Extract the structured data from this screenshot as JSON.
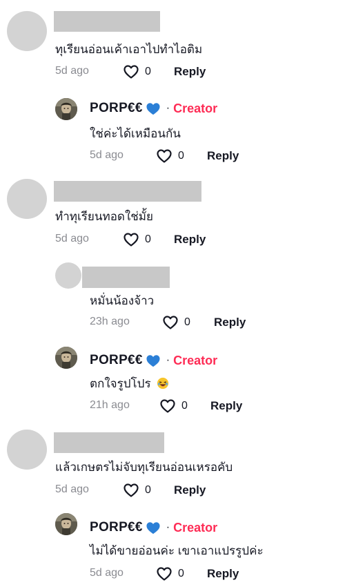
{
  "colors": {
    "creator_badge": "#fe2c55",
    "heart_blue": "#2b7fd6",
    "meta_gray": "#8a8b91"
  },
  "creator": {
    "name": "PORP€€",
    "badge": "Creator",
    "separator": "·"
  },
  "comments": [
    {
      "text": "ทุเรียนอ่อนเค้าเอาไปทำไอติม",
      "age": "5d ago",
      "likes": "0",
      "reply_label": "Reply"
    },
    {
      "text": "ใช่ค่ะได้เหมือนกัน",
      "age": "5d ago",
      "likes": "0",
      "reply_label": "Reply"
    },
    {
      "text": "ทำทุเรียนทอดใช่มั้ย",
      "age": "5d ago",
      "likes": "0",
      "reply_label": "Reply"
    },
    {
      "text": "หมั่นน้องจ้าว",
      "age": "23h ago",
      "likes": "0",
      "reply_label": "Reply"
    },
    {
      "text": "ตกใจรูปโปร",
      "emoji": "laughing-face-emoji",
      "age": "21h ago",
      "likes": "0",
      "reply_label": "Reply"
    },
    {
      "text": "แล้วเกษตรไม่จับทุเรียนอ่อนเหรอคับ",
      "age": "5d ago",
      "likes": "0",
      "reply_label": "Reply"
    },
    {
      "text": "ไม่ได้ขายอ่อนค่ะ เขาเอาแปรรูปค่ะ",
      "age": "5d ago",
      "likes": "0",
      "reply_label": "Reply"
    }
  ]
}
